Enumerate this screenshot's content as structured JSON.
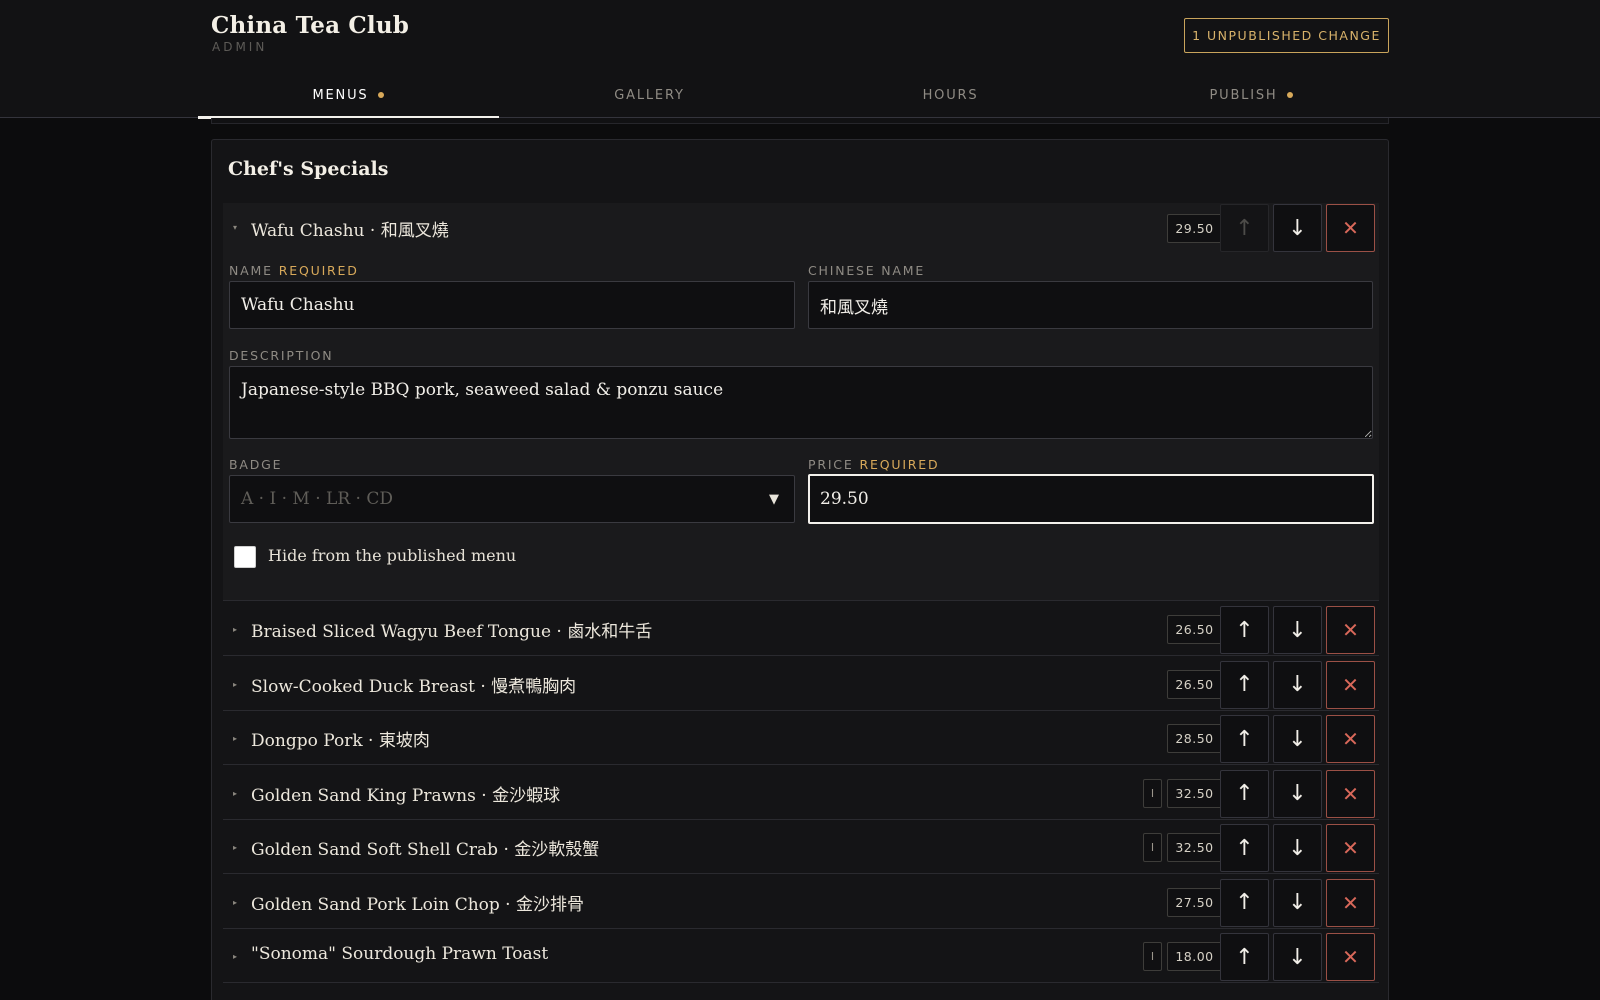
{
  "brand": {
    "title": "China Tea Club",
    "subtitle": "ADMIN"
  },
  "header": {
    "unpublished_label": "1 UNPUBLISHED CHANGE"
  },
  "tabs": [
    {
      "label": "MENUS",
      "dot": true,
      "active": true
    },
    {
      "label": "GALLERY",
      "dot": false,
      "active": false
    },
    {
      "label": "HOURS",
      "dot": false,
      "active": false
    },
    {
      "label": "PUBLISH",
      "dot": true,
      "active": false
    }
  ],
  "section": {
    "title": "Chef's Specials",
    "expanded_item": {
      "summary": "Wafu Chashu · 和風叉燒",
      "price": "29.50",
      "form": {
        "name_label": "NAME",
        "chinese_name_label": "CHINESE NAME",
        "required_label": "REQUIRED",
        "name_value": "Wafu Chashu",
        "chinese_name_value": "和風叉燒",
        "description_label": "DESCRIPTION",
        "description_value": "Japanese-style BBQ pork, seaweed salad & ponzu sauce",
        "badge_label": "BADGE",
        "badge_placeholder": "A · I · M · LR · CD",
        "price_label": "PRICE",
        "price_value": "29.50",
        "hide_label": "Hide from the published menu"
      }
    },
    "items": [
      {
        "name": "Braised Sliced Wagyu Beef Tongue · 鹵水和牛舌",
        "price": "26.50",
        "badge": ""
      },
      {
        "name": "Slow-Cooked Duck Breast · 慢煮鴨胸肉",
        "price": "26.50",
        "badge": ""
      },
      {
        "name": "Dongpo Pork · 東坡肉",
        "price": "28.50",
        "badge": ""
      },
      {
        "name": "Golden Sand King Prawns · 金沙蝦球",
        "price": "32.50",
        "badge": "I"
      },
      {
        "name": "Golden Sand Soft Shell Crab · 金沙軟殼蟹",
        "price": "32.50",
        "badge": "I"
      },
      {
        "name": "Golden Sand Pork Loin Chop · 金沙排骨",
        "price": "27.50",
        "badge": ""
      },
      {
        "name": "\"Sonoma\" Sourdough Prawn Toast",
        "price": "18.00",
        "badge": "I"
      }
    ]
  },
  "icons": {
    "caret_collapsed": "▸",
    "caret_expanded": "▾",
    "up": "↑",
    "down": "↓",
    "delete": "✕",
    "select": "▼"
  }
}
